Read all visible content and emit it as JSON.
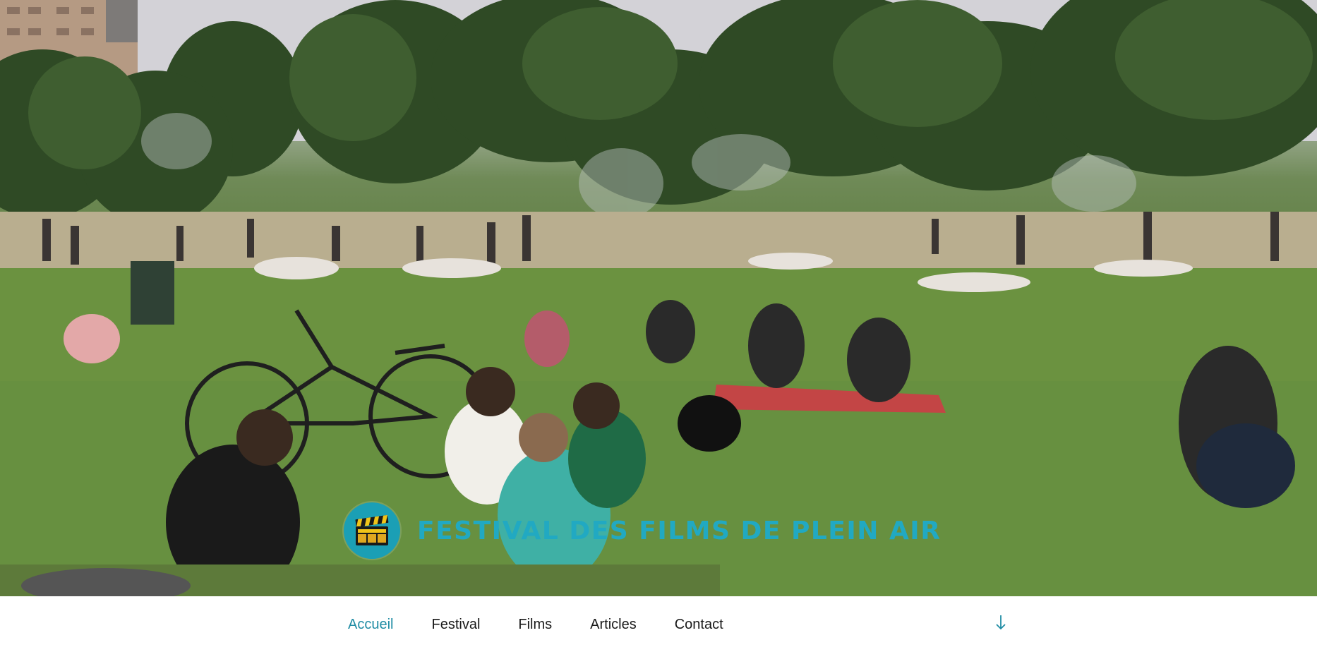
{
  "site": {
    "title": "FESTIVAL DES FILMS DE PLEIN AIR"
  },
  "icons": {
    "logo": "clapperboard-icon",
    "scroll": "arrow-down-icon"
  },
  "colors": {
    "brand": "#21a9c2",
    "logo_bg": "#1b9fb5",
    "nav_active": "#1f8ca4",
    "nav_text": "#1a1a1a"
  },
  "nav": {
    "items": [
      {
        "label": "Accueil",
        "active": true
      },
      {
        "label": "Festival",
        "active": false
      },
      {
        "label": "Films",
        "active": false
      },
      {
        "label": "Articles",
        "active": false
      },
      {
        "label": "Contact",
        "active": false
      }
    ]
  }
}
